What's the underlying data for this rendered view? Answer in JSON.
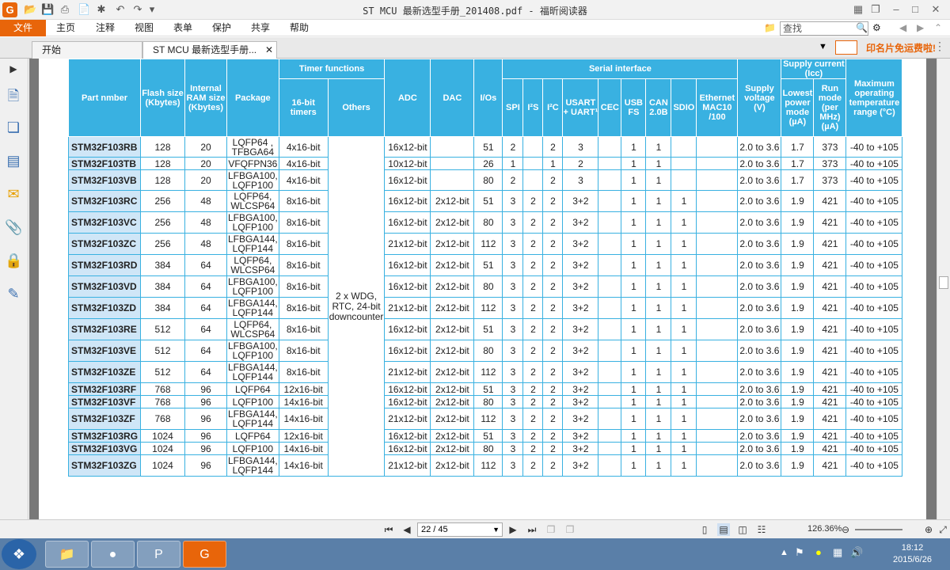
{
  "window": {
    "title": "ST MCU 最新选型手册_201408.pdf - 福昕阅读器",
    "app_icon": "G"
  },
  "menu": {
    "file": "文件",
    "items": [
      "主页",
      "注释",
      "视图",
      "表单",
      "保护",
      "共享",
      "帮助"
    ],
    "search_placeholder": "查找"
  },
  "tabs": [
    {
      "label": "开始"
    },
    {
      "label": "ST MCU 最新选型手册..."
    }
  ],
  "ad_text": "印名片免运费啦!",
  "table": {
    "group_headers": {
      "timer": "Timer functions",
      "serial": "Serial interface"
    },
    "headers": {
      "part": "Part nmber",
      "flash": "Flash size (Kbytes)",
      "ram": "Internal RAM size (Kbytes)",
      "package": "Package",
      "timer16": "16-bit timers",
      "others": "Others",
      "adc": "ADC",
      "dac": "DAC",
      "ios": "I/Os",
      "spi": "SPI",
      "i2s": "I²S",
      "i2c": "I²C",
      "usart": "USART + UART¹",
      "cec": "CEC",
      "usb": "USB FS",
      "can": "CAN 2.0B",
      "sdio": "SDIO",
      "eth": "Ethernet MAC10 /100",
      "supply": "Supply voltage (V)",
      "supply_current": "Supply current (Icc)",
      "lowest": "Lowest power mode (µA)",
      "run": "Run mode (per MHz) (µA)",
      "temp": "Maximum operating temperature range (°C)"
    },
    "others_value": "2 x WDG, RTC, 24-bit downcounter",
    "rows": [
      [
        "STM32F103RB",
        "128",
        "20",
        "LQFP64 , TFBGA64",
        "4x16-bit",
        "16x12-bit",
        "",
        "51",
        "2",
        "",
        "2",
        "3",
        "",
        "1",
        "1",
        "",
        "",
        "2.0 to 3.6",
        "1.7",
        "373",
        "-40 to +105"
      ],
      [
        "STM32F103TB",
        "128",
        "20",
        "VFQFPN36",
        "4x16-bit",
        "10x12-bit",
        "",
        "26",
        "1",
        "",
        "1",
        "2",
        "",
        "1",
        "1",
        "",
        "",
        "2.0 to 3.6",
        "1.7",
        "373",
        "-40 to +105"
      ],
      [
        "STM32F103VB",
        "128",
        "20",
        "LFBGA100, LQFP100",
        "4x16-bit",
        "16x12-bit",
        "",
        "80",
        "2",
        "",
        "2",
        "3",
        "",
        "1",
        "1",
        "",
        "",
        "2.0 to 3.6",
        "1.7",
        "373",
        "-40 to +105"
      ],
      [
        "STM32F103RC",
        "256",
        "48",
        "LQFP64, WLCSP64",
        "8x16-bit",
        "16x12-bit",
        "2x12-bit",
        "51",
        "3",
        "2",
        "2",
        "3+2",
        "",
        "1",
        "1",
        "1",
        "",
        "2.0 to 3.6",
        "1.9",
        "421",
        "-40 to +105"
      ],
      [
        "STM32F103VC",
        "256",
        "48",
        "LFBGA100, LQFP100",
        "8x16-bit",
        "16x12-bit",
        "2x12-bit",
        "80",
        "3",
        "2",
        "2",
        "3+2",
        "",
        "1",
        "1",
        "1",
        "",
        "2.0 to 3.6",
        "1.9",
        "421",
        "-40 to +105"
      ],
      [
        "STM32F103ZC",
        "256",
        "48",
        "LFBGA144, LQFP144",
        "8x16-bit",
        "21x12-bit",
        "2x12-bit",
        "112",
        "3",
        "2",
        "2",
        "3+2",
        "",
        "1",
        "1",
        "1",
        "",
        "2.0 to 3.6",
        "1.9",
        "421",
        "-40 to +105"
      ],
      [
        "STM32F103RD",
        "384",
        "64",
        "LQFP64, WLCSP64",
        "8x16-bit",
        "16x12-bit",
        "2x12-bit",
        "51",
        "3",
        "2",
        "2",
        "3+2",
        "",
        "1",
        "1",
        "1",
        "",
        "2.0 to 3.6",
        "1.9",
        "421",
        "-40 to +105"
      ],
      [
        "STM32F103VD",
        "384",
        "64",
        "LFBGA100, LQFP100",
        "8x16-bit",
        "16x12-bit",
        "2x12-bit",
        "80",
        "3",
        "2",
        "2",
        "3+2",
        "",
        "1",
        "1",
        "1",
        "",
        "2.0 to 3.6",
        "1.9",
        "421",
        "-40 to +105"
      ],
      [
        "STM32F103ZD",
        "384",
        "64",
        "LFBGA144, LQFP144",
        "8x16-bit",
        "21x12-bit",
        "2x12-bit",
        "112",
        "3",
        "2",
        "2",
        "3+2",
        "",
        "1",
        "1",
        "1",
        "",
        "2.0 to 3.6",
        "1.9",
        "421",
        "-40 to +105"
      ],
      [
        "STM32F103RE",
        "512",
        "64",
        "LQFP64, WLCSP64",
        "8x16-bit",
        "16x12-bit",
        "2x12-bit",
        "51",
        "3",
        "2",
        "2",
        "3+2",
        "",
        "1",
        "1",
        "1",
        "",
        "2.0 to 3.6",
        "1.9",
        "421",
        "-40 to +105"
      ],
      [
        "STM32F103VE",
        "512",
        "64",
        "LFBGA100, LQFP100",
        "8x16-bit",
        "16x12-bit",
        "2x12-bit",
        "80",
        "3",
        "2",
        "2",
        "3+2",
        "",
        "1",
        "1",
        "1",
        "",
        "2.0 to 3.6",
        "1.9",
        "421",
        "-40 to +105"
      ],
      [
        "STM32F103ZE",
        "512",
        "64",
        "LFBGA144, LQFP144",
        "8x16-bit",
        "21x12-bit",
        "2x12-bit",
        "112",
        "3",
        "2",
        "2",
        "3+2",
        "",
        "1",
        "1",
        "1",
        "",
        "2.0 to 3.6",
        "1.9",
        "421",
        "-40 to +105"
      ],
      [
        "STM32F103RF",
        "768",
        "96",
        "LQFP64",
        "12x16-bit",
        "16x12-bit",
        "2x12-bit",
        "51",
        "3",
        "2",
        "2",
        "3+2",
        "",
        "1",
        "1",
        "1",
        "",
        "2.0 to 3.6",
        "1.9",
        "421",
        "-40 to +105"
      ],
      [
        "STM32F103VF",
        "768",
        "96",
        "LQFP100",
        "14x16-bit",
        "16x12-bit",
        "2x12-bit",
        "80",
        "3",
        "2",
        "2",
        "3+2",
        "",
        "1",
        "1",
        "1",
        "",
        "2.0 to 3.6",
        "1.9",
        "421",
        "-40 to +105"
      ],
      [
        "STM32F103ZF",
        "768",
        "96",
        "LFBGA144, LQFP144",
        "14x16-bit",
        "21x12-bit",
        "2x12-bit",
        "112",
        "3",
        "2",
        "2",
        "3+2",
        "",
        "1",
        "1",
        "1",
        "",
        "2.0 to 3.6",
        "1.9",
        "421",
        "-40 to +105"
      ],
      [
        "STM32F103RG",
        "1024",
        "96",
        "LQFP64",
        "12x16-bit",
        "16x12-bit",
        "2x12-bit",
        "51",
        "3",
        "2",
        "2",
        "3+2",
        "",
        "1",
        "1",
        "1",
        "",
        "2.0 to 3.6",
        "1.9",
        "421",
        "-40 to +105"
      ],
      [
        "STM32F103VG",
        "1024",
        "96",
        "LQFP100",
        "14x16-bit",
        "16x12-bit",
        "2x12-bit",
        "80",
        "3",
        "2",
        "2",
        "3+2",
        "",
        "1",
        "1",
        "1",
        "",
        "2.0 to 3.6",
        "1.9",
        "421",
        "-40 to +105"
      ],
      [
        "STM32F103ZG",
        "1024",
        "96",
        "LFBGA144, LQFP144",
        "14x16-bit",
        "21x12-bit",
        "2x12-bit",
        "112",
        "3",
        "2",
        "2",
        "3+2",
        "",
        "1",
        "1",
        "1",
        "",
        "2.0 to 3.6",
        "1.9",
        "421",
        "-40 to +105"
      ]
    ]
  },
  "status": {
    "page_indicator": "22 / 45",
    "zoom": "126.36%"
  },
  "taskbar": {
    "time": "18:12",
    "date": "2015/6/26"
  }
}
